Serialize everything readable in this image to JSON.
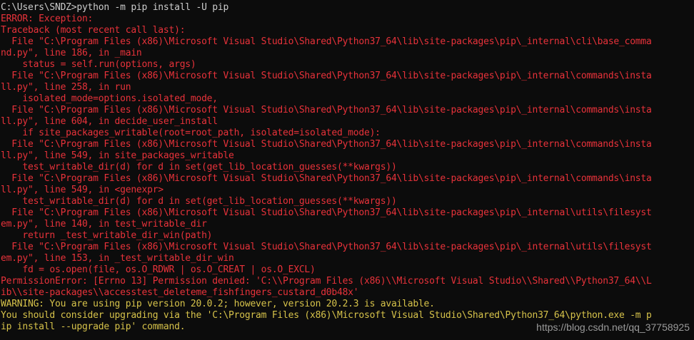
{
  "colors": {
    "background": "#0c0c0c",
    "prompt_text": "#cccccc",
    "error_text": "#e8323a",
    "warning_text": "#d6c24a",
    "watermark_text": "#9a9a9a"
  },
  "terminal": {
    "lines": [
      {
        "text": "C:\\Users\\SNDZ>python -m pip install -U pip",
        "color": "white"
      },
      {
        "text": "ERROR: Exception:",
        "color": "red"
      },
      {
        "text": "Traceback (most recent call last):",
        "color": "red"
      },
      {
        "text": "  File \"C:\\Program Files (x86)\\Microsoft Visual Studio\\Shared\\Python37_64\\lib\\site-packages\\pip\\_internal\\cli\\base_comma",
        "color": "red"
      },
      {
        "text": "nd.py\", line 186, in _main",
        "color": "red"
      },
      {
        "text": "    status = self.run(options, args)",
        "color": "red"
      },
      {
        "text": "  File \"C:\\Program Files (x86)\\Microsoft Visual Studio\\Shared\\Python37_64\\lib\\site-packages\\pip\\_internal\\commands\\insta",
        "color": "red"
      },
      {
        "text": "ll.py\", line 258, in run",
        "color": "red"
      },
      {
        "text": "    isolated_mode=options.isolated_mode,",
        "color": "red"
      },
      {
        "text": "  File \"C:\\Program Files (x86)\\Microsoft Visual Studio\\Shared\\Python37_64\\lib\\site-packages\\pip\\_internal\\commands\\insta",
        "color": "red"
      },
      {
        "text": "ll.py\", line 604, in decide_user_install",
        "color": "red"
      },
      {
        "text": "    if site_packages_writable(root=root_path, isolated=isolated_mode):",
        "color": "red"
      },
      {
        "text": "  File \"C:\\Program Files (x86)\\Microsoft Visual Studio\\Shared\\Python37_64\\lib\\site-packages\\pip\\_internal\\commands\\insta",
        "color": "red"
      },
      {
        "text": "ll.py\", line 549, in site_packages_writable",
        "color": "red"
      },
      {
        "text": "    test_writable_dir(d) for d in set(get_lib_location_guesses(**kwargs))",
        "color": "red"
      },
      {
        "text": "  File \"C:\\Program Files (x86)\\Microsoft Visual Studio\\Shared\\Python37_64\\lib\\site-packages\\pip\\_internal\\commands\\insta",
        "color": "red"
      },
      {
        "text": "ll.py\", line 549, in <genexpr>",
        "color": "red"
      },
      {
        "text": "    test_writable_dir(d) for d in set(get_lib_location_guesses(**kwargs))",
        "color": "red"
      },
      {
        "text": "  File \"C:\\Program Files (x86)\\Microsoft Visual Studio\\Shared\\Python37_64\\lib\\site-packages\\pip\\_internal\\utils\\filesyst",
        "color": "red"
      },
      {
        "text": "em.py\", line 140, in test_writable_dir",
        "color": "red"
      },
      {
        "text": "    return _test_writable_dir_win(path)",
        "color": "red"
      },
      {
        "text": "  File \"C:\\Program Files (x86)\\Microsoft Visual Studio\\Shared\\Python37_64\\lib\\site-packages\\pip\\_internal\\utils\\filesyst",
        "color": "red"
      },
      {
        "text": "em.py\", line 153, in _test_writable_dir_win",
        "color": "red"
      },
      {
        "text": "    fd = os.open(file, os.O_RDWR | os.O_CREAT | os.O_EXCL)",
        "color": "red"
      },
      {
        "text": "PermissionError: [Errno 13] Permission denied: 'C:\\\\Program Files (x86)\\\\Microsoft Visual Studio\\\\Shared\\\\Python37_64\\\\L",
        "color": "red"
      },
      {
        "text": "ib\\\\site-packages\\\\accesstest_deleteme_fishfingers_custard_d0b48x'",
        "color": "red"
      },
      {
        "text": "WARNING: You are using pip version 20.0.2; however, version 20.2.3 is available.",
        "color": "yellow"
      },
      {
        "text": "You should consider upgrading via the 'C:\\Program Files (x86)\\Microsoft Visual Studio\\Shared\\Python37_64\\python.exe -m p",
        "color": "yellow"
      },
      {
        "text": "ip install --upgrade pip' command.",
        "color": "yellow"
      }
    ]
  },
  "watermark": {
    "text": "https://blog.csdn.net/qq_37758925"
  }
}
